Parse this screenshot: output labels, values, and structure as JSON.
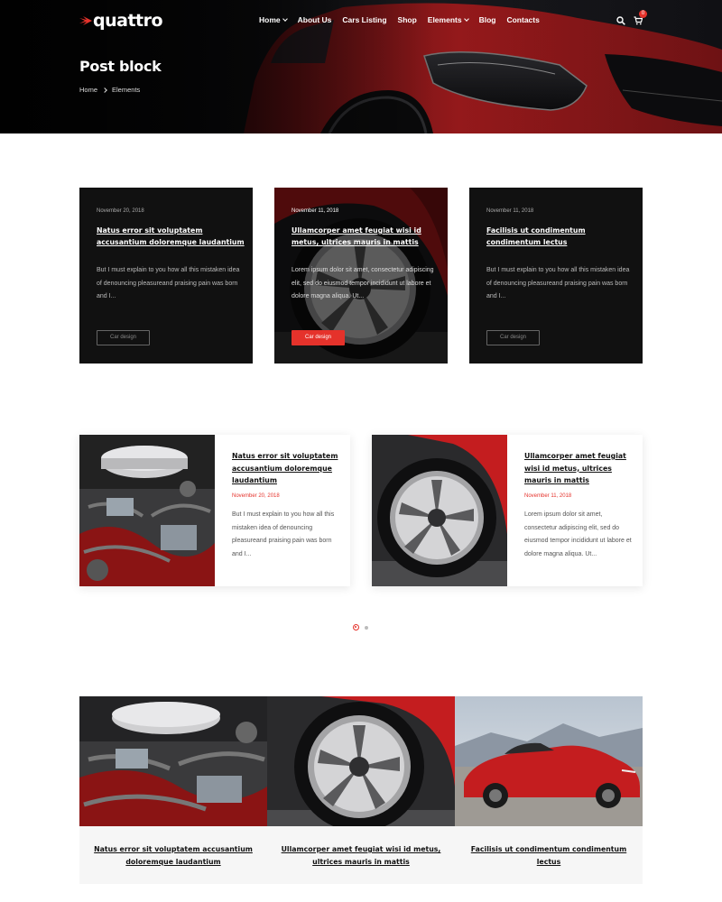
{
  "header": {
    "logo_text": "quattro",
    "nav": [
      {
        "label": "Home",
        "has_dropdown": true
      },
      {
        "label": "About Us",
        "has_dropdown": false
      },
      {
        "label": "Cars Listing",
        "has_dropdown": false
      },
      {
        "label": "Shop",
        "has_dropdown": false
      },
      {
        "label": "Elements",
        "has_dropdown": true
      },
      {
        "label": "Blog",
        "has_dropdown": false
      },
      {
        "label": "Contacts",
        "has_dropdown": false
      }
    ],
    "cart_count": "0",
    "icons": [
      "search-icon",
      "cart-icon"
    ]
  },
  "hero": {
    "title": "Post block",
    "breadcrumb": [
      "Home",
      "Elements"
    ]
  },
  "colors": {
    "accent": "#e5322b",
    "dark": "#111111"
  },
  "posts": [
    {
      "date": "November 20, 2018",
      "title": "Natus error sit voluptatem accusantium doloremque laudantium",
      "excerpt_dark": "But I must explain to you how all this mistaken idea of denouncing pleasureand praising pain was born and I...",
      "excerpt_light": "But I must explain to you how all this mistaken idea of denouncing pleasureand praising pain was born and I...",
      "category": "Car design",
      "image": "engine"
    },
    {
      "date": "November 11, 2018",
      "title": "Ullamcorper amet feugiat wisi id metus, ultrices mauris in mattis",
      "excerpt_dark": "Lorem ipsum dolor sit amet, consectetur adipiscing elit, sed do eiusmod tempor incididunt ut labore et dolore magna aliqua. Ut...",
      "excerpt_light": "Lorem ipsum dolor sit amet, consectetur adipiscing elit, sed do eiusmod tempor incididunt ut labore et dolore magna aliqua. Ut...",
      "category": "Car design",
      "image": "wheel"
    },
    {
      "date": "November 11, 2018",
      "title": "Facilisis ut condimentum condimentum lectus",
      "excerpt_dark": "But I must explain to you how all this mistaken idea of denouncing pleasureand praising pain was born and I...",
      "category": "Car design",
      "image": "red-convertible"
    }
  ],
  "slider": {
    "pages": 2,
    "active_page": 1
  }
}
